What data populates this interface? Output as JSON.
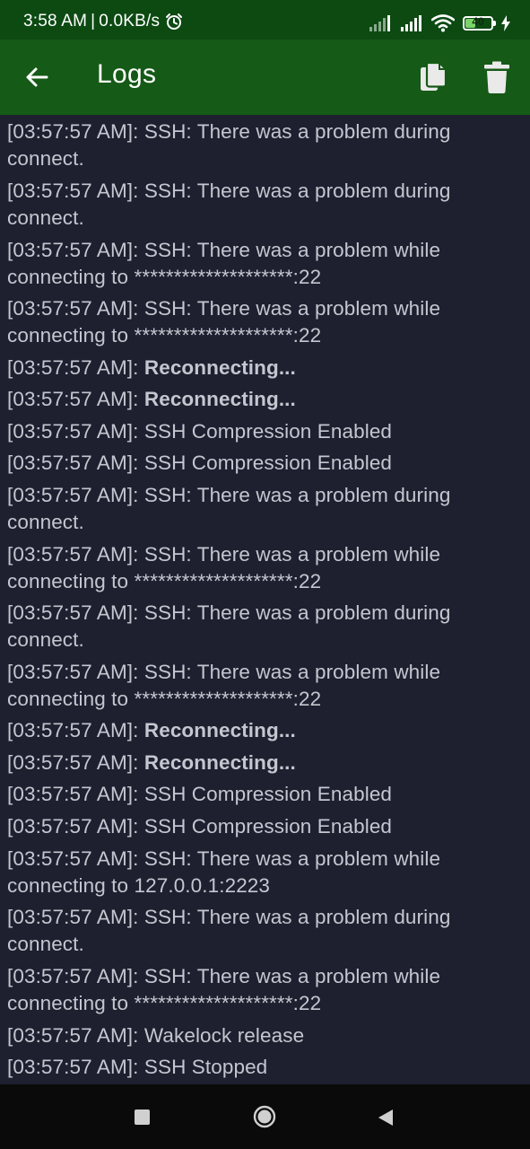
{
  "status_bar": {
    "time": "3:58 AM",
    "separator": "|",
    "speed": "0.0KB/s",
    "battery_level": "40",
    "battery_fill": 0.4
  },
  "toolbar": {
    "title": "Logs"
  },
  "logs": [
    {
      "time": "[03:57:57 AM]:",
      "msg": "SSH: There was a problem during connect.",
      "bold": false
    },
    {
      "time": "[03:57:57 AM]:",
      "msg": "SSH: There was a problem during connect.",
      "bold": false
    },
    {
      "time": "[03:57:57 AM]:",
      "msg": "SSH: There was a problem while connecting to ********************:22",
      "bold": false
    },
    {
      "time": "[03:57:57 AM]:",
      "msg": "SSH: There was a problem while connecting to ********************:22",
      "bold": false
    },
    {
      "time": "[03:57:57 AM]:",
      "msg": "Reconnecting...",
      "bold": true
    },
    {
      "time": "[03:57:57 AM]:",
      "msg": "Reconnecting...",
      "bold": true
    },
    {
      "time": "[03:57:57 AM]:",
      "msg": "SSH Compression Enabled",
      "bold": false
    },
    {
      "time": "[03:57:57 AM]:",
      "msg": "SSH Compression Enabled",
      "bold": false
    },
    {
      "time": "[03:57:57 AM]:",
      "msg": "SSH: There was a problem during connect.",
      "bold": false
    },
    {
      "time": "[03:57:57 AM]:",
      "msg": "SSH: There was a problem while connecting to ********************:22",
      "bold": false
    },
    {
      "time": "[03:57:57 AM]:",
      "msg": "SSH: There was a problem during connect.",
      "bold": false
    },
    {
      "time": "[03:57:57 AM]:",
      "msg": "SSH: There was a problem while connecting to ********************:22",
      "bold": false
    },
    {
      "time": "[03:57:57 AM]:",
      "msg": "Reconnecting...",
      "bold": true
    },
    {
      "time": "[03:57:57 AM]:",
      "msg": "Reconnecting...",
      "bold": true
    },
    {
      "time": "[03:57:57 AM]:",
      "msg": "SSH Compression Enabled",
      "bold": false
    },
    {
      "time": "[03:57:57 AM]:",
      "msg": "SSH Compression Enabled",
      "bold": false
    },
    {
      "time": "[03:57:57 AM]:",
      "msg": "SSH: There was a problem while connecting to 127.0.0.1:2223",
      "bold": false
    },
    {
      "time": "[03:57:57 AM]:",
      "msg": "SSH: There was a problem during connect.",
      "bold": false
    },
    {
      "time": "[03:57:57 AM]:",
      "msg": "SSH: There was a problem while connecting to ********************:22",
      "bold": false
    },
    {
      "time": "[03:57:57 AM]:",
      "msg": "Wakelock release",
      "bold": false
    },
    {
      "time": "[03:57:57 AM]:",
      "msg": "SSH Stopped",
      "bold": false
    }
  ],
  "icons": {
    "status": [
      "alarm-clock-icon",
      "signal-icon",
      "signal-icon",
      "wifi-icon",
      "battery-icon",
      "charging-icon"
    ],
    "toolbar": [
      "arrow-back-icon",
      "copy-icon",
      "delete-icon"
    ],
    "nav": [
      "recent-apps-icon",
      "home-icon",
      "back-icon"
    ]
  },
  "colors": {
    "status_bar": "#0c4a12",
    "toolbar": "#155a16",
    "background": "#1e2030",
    "log_text": "#c4c7cf",
    "nav_bar": "#0a0a0a"
  }
}
